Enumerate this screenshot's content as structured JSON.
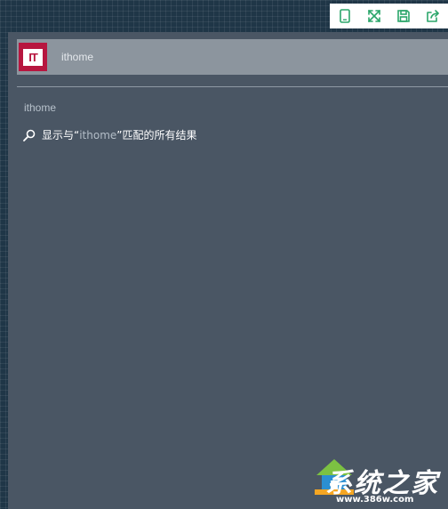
{
  "toolbar": {
    "icons": [
      "tablet-icon",
      "expand-icon",
      "save-icon",
      "share-icon"
    ],
    "accent_color": "#2ba66a"
  },
  "search": {
    "app_logo_text": "IT",
    "query": "ithome"
  },
  "results": {
    "section_header": "ithome",
    "show_all": {
      "prefix": "显示与“",
      "query": "ithome",
      "suffix": "”匹配的所有结果"
    }
  },
  "colors": {
    "panel_bg": "#4a5664",
    "search_box_bg": "#8c959e",
    "logo_bg": "#b7163f"
  },
  "watermark": {
    "brand": "系统之家",
    "url": "www.386w.com"
  }
}
